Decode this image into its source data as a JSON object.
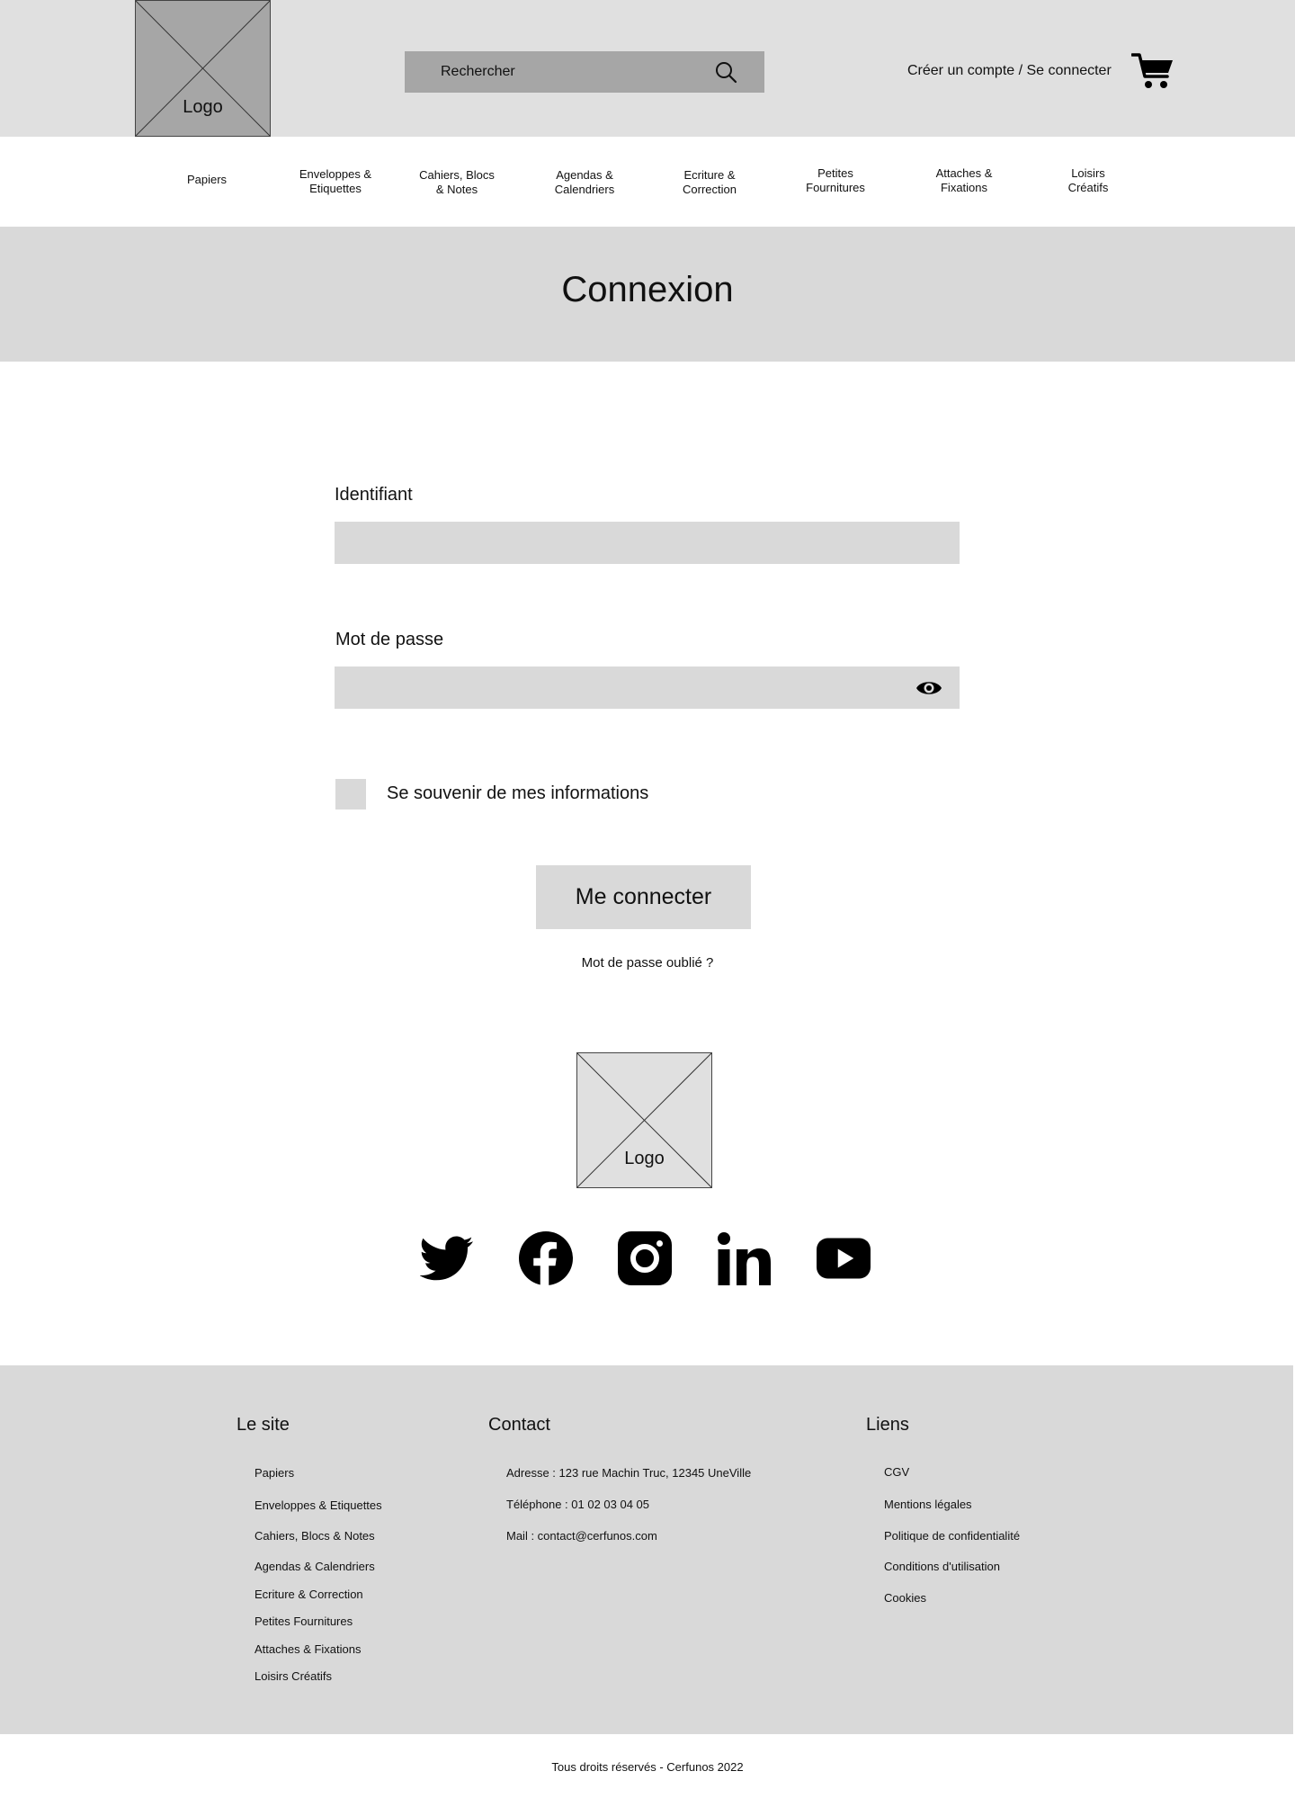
{
  "header": {
    "logo_label": "Logo",
    "search": {
      "placeholder": "Rechercher"
    },
    "account_link": "Créer un compte / Se connecter"
  },
  "nav": {
    "items": [
      {
        "line1": "Papiers",
        "line2": ""
      },
      {
        "line1": "Enveloppes &",
        "line2": "Etiquettes"
      },
      {
        "line1": "Cahiers, Blocs",
        "line2": "& Notes"
      },
      {
        "line1": "Agendas &",
        "line2": "Calendriers"
      },
      {
        "line1": "Ecriture &",
        "line2": "Correction"
      },
      {
        "line1": "Petites",
        "line2": "Fournitures"
      },
      {
        "line1": "Attaches &",
        "line2": "Fixations"
      },
      {
        "line1": "Loisirs",
        "line2": "Créatifs"
      }
    ]
  },
  "banner": {
    "title": "Connexion"
  },
  "form": {
    "username_label": "Identifiant",
    "username_value": "",
    "password_label": "Mot de passe",
    "password_value": "",
    "remember_label": "Se souvenir de mes informations",
    "submit_label": "Me connecter",
    "forgot_link": "Mot de passe oublié ?"
  },
  "brand": {
    "logo_label": "Logo"
  },
  "social": [
    "twitter-icon",
    "facebook-icon",
    "instagram-icon",
    "linkedin-icon",
    "youtube-icon"
  ],
  "footer": {
    "site": {
      "heading": "Le site",
      "links": [
        "Papiers",
        "Enveloppes & Etiquettes",
        "Cahiers, Blocs & Notes",
        "Agendas & Calendriers",
        "Ecriture & Correction",
        "Petites Fournitures",
        "Attaches & Fixations",
        "Loisirs Créatifs"
      ]
    },
    "contact": {
      "heading": "Contact",
      "lines": [
        "Adresse : 123 rue Machin Truc, 12345 UneVille",
        "Téléphone : 01 02 03 04 05",
        "Mail : contact@cerfunos.com"
      ]
    },
    "links": {
      "heading": "Liens",
      "items": [
        "CGV",
        "Mentions légales",
        "Politique de confidentialité",
        "Conditions d'utilisation",
        "Cookies"
      ]
    },
    "copyright": "Tous droits réservés - Cerfunos 2022"
  },
  "colors": {
    "header_bg": "#e0e0e0",
    "search_bg": "#a6a6a6",
    "panel_bg": "#d9d9d9",
    "text": "#111111"
  }
}
